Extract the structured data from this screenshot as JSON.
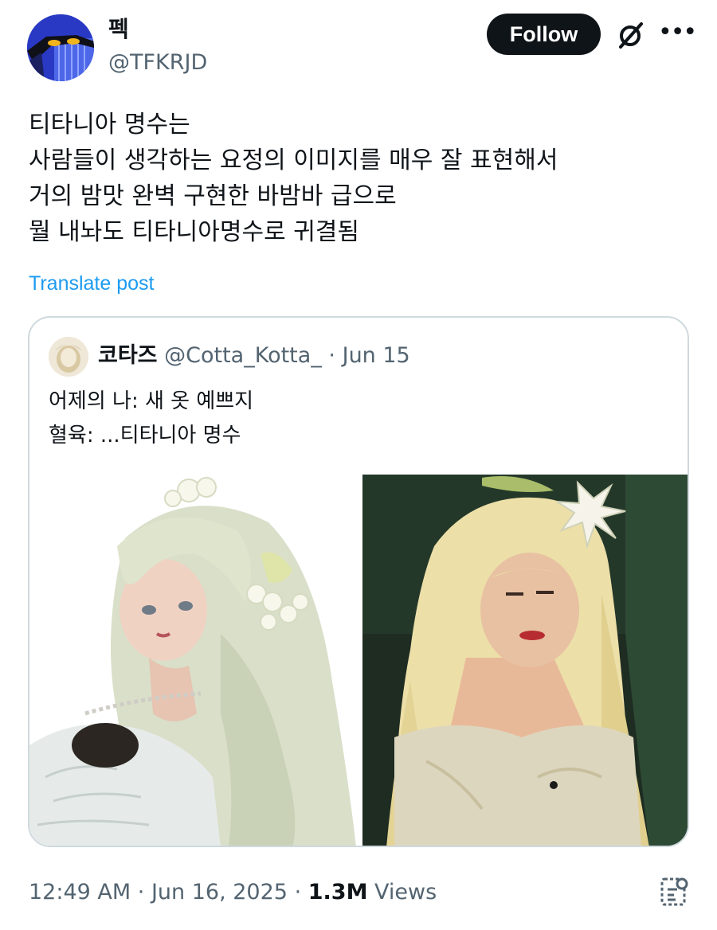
{
  "author": {
    "display_name": "펙",
    "handle": "@TFKRJD"
  },
  "actions": {
    "follow_label": "Follow",
    "grok_icon": "grok-icon",
    "more_icon": "more-icon"
  },
  "tweet": {
    "lines": [
      "티타니아 명수는",
      "사람들이 생각하는 요정의 이미지를 매우 잘 표현해서",
      "거의 밤맛 완벽 구현한 바밤바 급으로",
      "뭘 내놔도 티타니아명수로 귀결됨"
    ],
    "translate_label": "Translate post"
  },
  "quote": {
    "display_name": "코타즈",
    "handle": "@Cotta_Kotta_",
    "separator": "·",
    "date": "Jun 15",
    "lines": [
      "어제의 나: 새 옷 예쁘지",
      "혈육: ...티타니아 명수"
    ],
    "images": [
      "doll-photo",
      "titania-photo"
    ]
  },
  "footer": {
    "time": "12:49 AM",
    "separator": "·",
    "date": "Jun 16, 2025",
    "views_count": "1.3M",
    "views_label": "Views",
    "analytics_icon": "analytics-icon"
  },
  "colors": {
    "text": "#0f1419",
    "secondary": "#536471",
    "link": "#1d9bf0",
    "border": "#cfd9de"
  }
}
